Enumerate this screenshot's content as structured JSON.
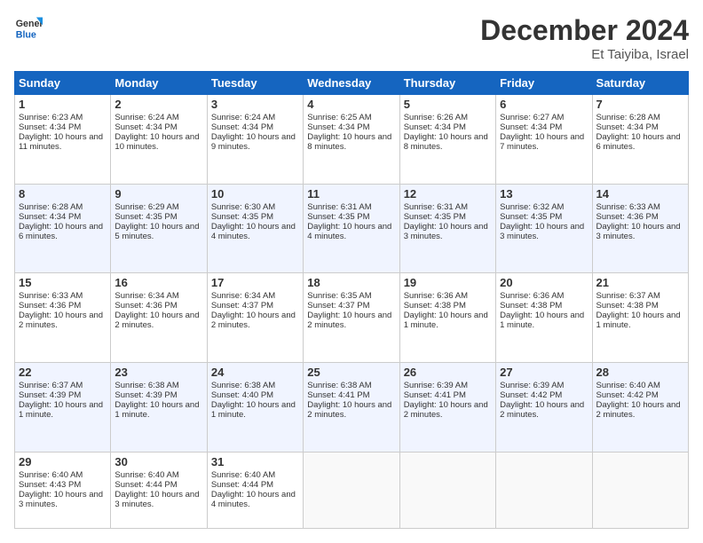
{
  "header": {
    "logo_line1": "General",
    "logo_line2": "Blue",
    "month": "December 2024",
    "location": "Et Taiyiba, Israel"
  },
  "days_of_week": [
    "Sunday",
    "Monday",
    "Tuesday",
    "Wednesday",
    "Thursday",
    "Friday",
    "Saturday"
  ],
  "weeks": [
    [
      {
        "day": 1,
        "rise": "6:23 AM",
        "set": "4:34 PM",
        "daylight": "10 hours and 11 minutes."
      },
      {
        "day": 2,
        "rise": "6:24 AM",
        "set": "4:34 PM",
        "daylight": "10 hours and 10 minutes."
      },
      {
        "day": 3,
        "rise": "6:24 AM",
        "set": "4:34 PM",
        "daylight": "10 hours and 9 minutes."
      },
      {
        "day": 4,
        "rise": "6:25 AM",
        "set": "4:34 PM",
        "daylight": "10 hours and 8 minutes."
      },
      {
        "day": 5,
        "rise": "6:26 AM",
        "set": "4:34 PM",
        "daylight": "10 hours and 8 minutes."
      },
      {
        "day": 6,
        "rise": "6:27 AM",
        "set": "4:34 PM",
        "daylight": "10 hours and 7 minutes."
      },
      {
        "day": 7,
        "rise": "6:28 AM",
        "set": "4:34 PM",
        "daylight": "10 hours and 6 minutes."
      }
    ],
    [
      {
        "day": 8,
        "rise": "6:28 AM",
        "set": "4:34 PM",
        "daylight": "10 hours and 6 minutes."
      },
      {
        "day": 9,
        "rise": "6:29 AM",
        "set": "4:35 PM",
        "daylight": "10 hours and 5 minutes."
      },
      {
        "day": 10,
        "rise": "6:30 AM",
        "set": "4:35 PM",
        "daylight": "10 hours and 4 minutes."
      },
      {
        "day": 11,
        "rise": "6:31 AM",
        "set": "4:35 PM",
        "daylight": "10 hours and 4 minutes."
      },
      {
        "day": 12,
        "rise": "6:31 AM",
        "set": "4:35 PM",
        "daylight": "10 hours and 3 minutes."
      },
      {
        "day": 13,
        "rise": "6:32 AM",
        "set": "4:35 PM",
        "daylight": "10 hours and 3 minutes."
      },
      {
        "day": 14,
        "rise": "6:33 AM",
        "set": "4:36 PM",
        "daylight": "10 hours and 3 minutes."
      }
    ],
    [
      {
        "day": 15,
        "rise": "6:33 AM",
        "set": "4:36 PM",
        "daylight": "10 hours and 2 minutes."
      },
      {
        "day": 16,
        "rise": "6:34 AM",
        "set": "4:36 PM",
        "daylight": "10 hours and 2 minutes."
      },
      {
        "day": 17,
        "rise": "6:34 AM",
        "set": "4:37 PM",
        "daylight": "10 hours and 2 minutes."
      },
      {
        "day": 18,
        "rise": "6:35 AM",
        "set": "4:37 PM",
        "daylight": "10 hours and 2 minutes."
      },
      {
        "day": 19,
        "rise": "6:36 AM",
        "set": "4:38 PM",
        "daylight": "10 hours and 1 minute."
      },
      {
        "day": 20,
        "rise": "6:36 AM",
        "set": "4:38 PM",
        "daylight": "10 hours and 1 minute."
      },
      {
        "day": 21,
        "rise": "6:37 AM",
        "set": "4:38 PM",
        "daylight": "10 hours and 1 minute."
      }
    ],
    [
      {
        "day": 22,
        "rise": "6:37 AM",
        "set": "4:39 PM",
        "daylight": "10 hours and 1 minute."
      },
      {
        "day": 23,
        "rise": "6:38 AM",
        "set": "4:39 PM",
        "daylight": "10 hours and 1 minute."
      },
      {
        "day": 24,
        "rise": "6:38 AM",
        "set": "4:40 PM",
        "daylight": "10 hours and 1 minute."
      },
      {
        "day": 25,
        "rise": "6:38 AM",
        "set": "4:41 PM",
        "daylight": "10 hours and 2 minutes."
      },
      {
        "day": 26,
        "rise": "6:39 AM",
        "set": "4:41 PM",
        "daylight": "10 hours and 2 minutes."
      },
      {
        "day": 27,
        "rise": "6:39 AM",
        "set": "4:42 PM",
        "daylight": "10 hours and 2 minutes."
      },
      {
        "day": 28,
        "rise": "6:40 AM",
        "set": "4:42 PM",
        "daylight": "10 hours and 2 minutes."
      }
    ],
    [
      {
        "day": 29,
        "rise": "6:40 AM",
        "set": "4:43 PM",
        "daylight": "10 hours and 3 minutes."
      },
      {
        "day": 30,
        "rise": "6:40 AM",
        "set": "4:44 PM",
        "daylight": "10 hours and 3 minutes."
      },
      {
        "day": 31,
        "rise": "6:40 AM",
        "set": "4:44 PM",
        "daylight": "10 hours and 4 minutes."
      },
      null,
      null,
      null,
      null
    ]
  ]
}
